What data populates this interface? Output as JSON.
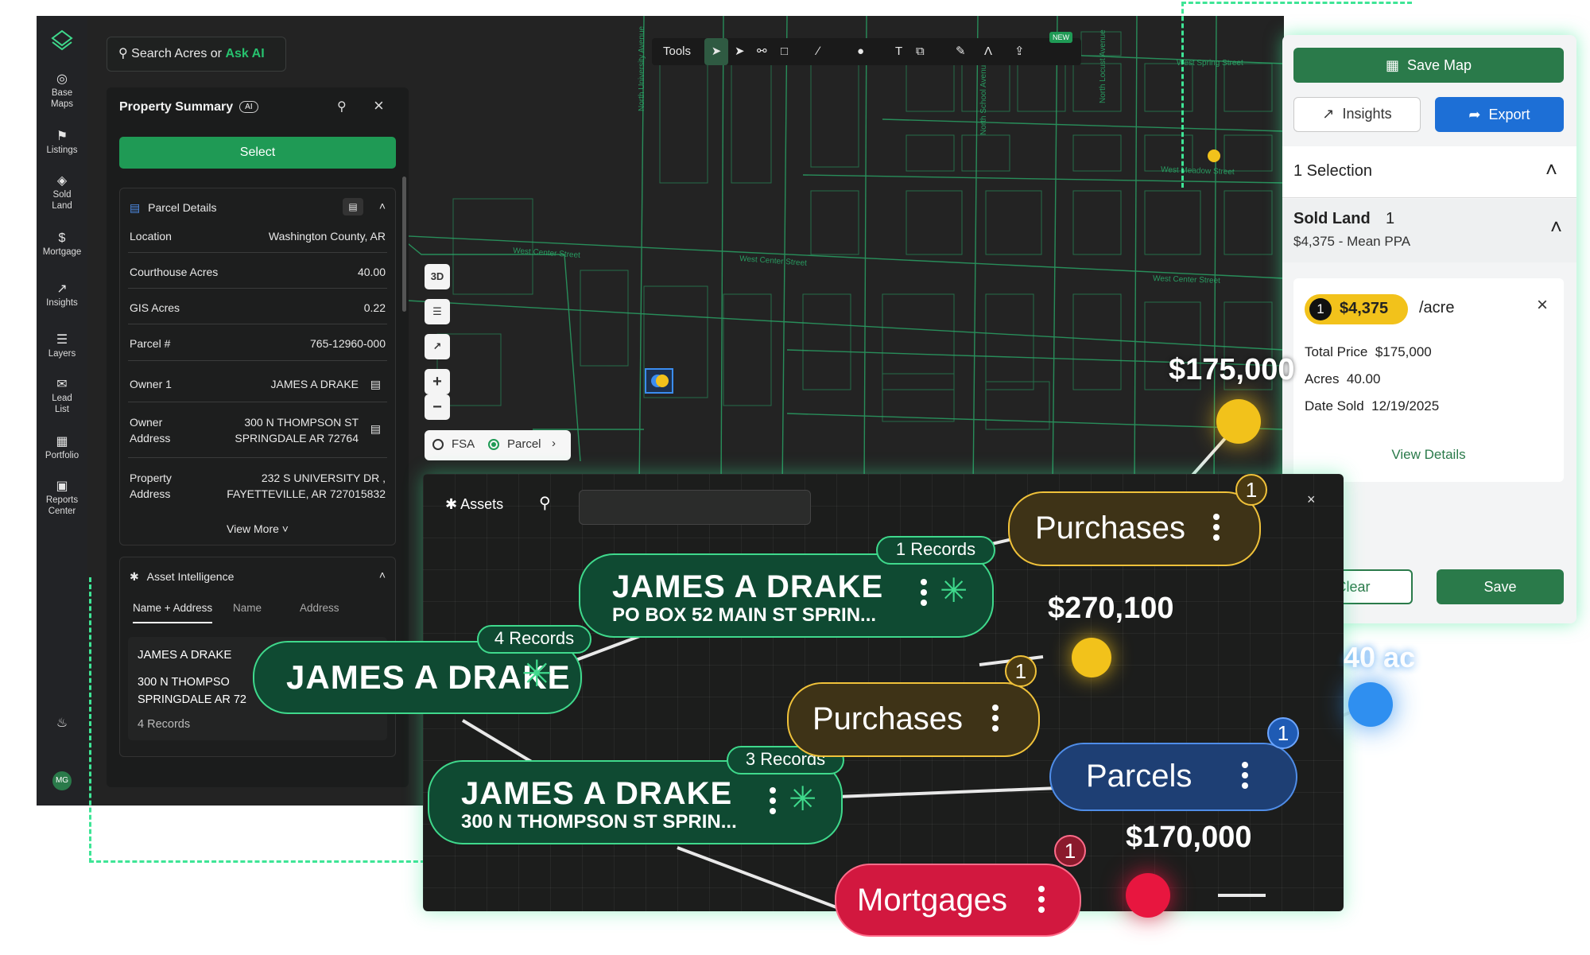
{
  "nav": {
    "items": [
      {
        "label": "Base\nMaps",
        "icon": "globe-icon"
      },
      {
        "label": "Listings",
        "icon": "flag-icon"
      },
      {
        "label": "Sold\nLand",
        "icon": "tag-icon"
      },
      {
        "label": "Mortgage",
        "icon": "dollar-icon"
      },
      {
        "label": "Insights",
        "icon": "insights-icon"
      },
      {
        "label": "Layers",
        "icon": "layers-icon"
      },
      {
        "label": "Lead\nList",
        "icon": "mail-icon"
      },
      {
        "label": "Portfolio",
        "icon": "map-icon"
      },
      {
        "label": "Reports\nCenter",
        "icon": "briefcase-icon"
      }
    ],
    "avatar": "MG"
  },
  "search": {
    "text": "Search Acres or ",
    "ai": "Ask AI"
  },
  "summary": {
    "title": "Property Summary",
    "ai_badge": "AI",
    "select_label": "Select",
    "parcel": {
      "title": "Parcel Details",
      "rows": [
        {
          "label": "Location",
          "value": "Washington County, AR"
        },
        {
          "label": "Courthouse Acres",
          "value": "40.00"
        },
        {
          "label": "GIS Acres",
          "value": "0.22"
        },
        {
          "label": "Parcel #",
          "value": "765-12960-000"
        },
        {
          "label": "Owner 1",
          "value": "JAMES A DRAKE"
        }
      ],
      "owner_address_label": "Owner\nAddress",
      "owner_address_value": "300 N THOMPSON ST\nSPRINGDALE AR 72764",
      "property_address_label": "Property\nAddress",
      "property_address_value": "232 S UNIVERSITY DR ,\nFAYETTEVILLE, AR 727015832",
      "view_more": "View More"
    },
    "asset_intel": {
      "title": "Asset Intelligence",
      "tabs": [
        "Name + Address",
        "Name",
        "Address"
      ],
      "result_name": "JAMES A DRAKE",
      "result_address": "300 N THOMPSO\nSPRINGDALE AR 72",
      "result_records": "4 Records"
    }
  },
  "toolbar": {
    "label": "Tools",
    "new_badge": "NEW"
  },
  "map_controls": {
    "threed": "3D",
    "plus": "+",
    "minus": "−"
  },
  "layer_toggle": {
    "fsa": "FSA",
    "parcel": "Parcel"
  },
  "streets": [
    "West Center Street",
    "West Center Street",
    "West Center Street",
    "West Spring Street",
    "West Meadow Street",
    "North University Avenue",
    "North School Avenue",
    "North Locust Avenue"
  ],
  "right_panel": {
    "save_map": "Save Map",
    "insights": "Insights",
    "export": "Export",
    "selection": "1 Selection",
    "sold_land_title": "Sold Land",
    "sold_land_count": "1",
    "mean_ppa": "$4,375 - Mean PPA",
    "listing": {
      "index": "1",
      "price": "$4,375",
      "unit": "/acre",
      "total_price_label": "Total Price",
      "total_price": "$175,000",
      "acres_label": "Acres",
      "acres": "40.00",
      "date_sold_label": "Date Sold",
      "date_sold": "12/19/2025",
      "view_details": "View Details"
    },
    "clear": "Clear",
    "save": "Save"
  },
  "assets": {
    "title": "Assets",
    "search_value": "",
    "nodes": {
      "drake_po": {
        "name": "JAMES A DRAKE",
        "address": "PO BOX 52 MAIN ST SPRIN...",
        "records": "1 Records"
      },
      "drake_main": {
        "name": "JAMES A DRAKE",
        "records": "4 Records"
      },
      "drake_thompson": {
        "name": "JAMES A DRAKE",
        "address": "300 N THOMPSON ST SPRIN...",
        "records": "3 Records"
      },
      "purchases_top": {
        "label": "Purchases",
        "count": "1"
      },
      "purchases_mid": {
        "label": "Purchases",
        "count": "1"
      },
      "parcels": {
        "label": "Parcels",
        "count": "1"
      },
      "mortgages": {
        "label": "Mortgages",
        "count": "1"
      }
    },
    "values": {
      "top": "$175,000",
      "mid": "$270,100",
      "bottom": "$170,000",
      "acres": "40 ac"
    }
  },
  "colors": {
    "accent_green": "#27c26e",
    "gold": "#f2c21b",
    "blue": "#2f8ff0",
    "red": "#e8163f"
  }
}
